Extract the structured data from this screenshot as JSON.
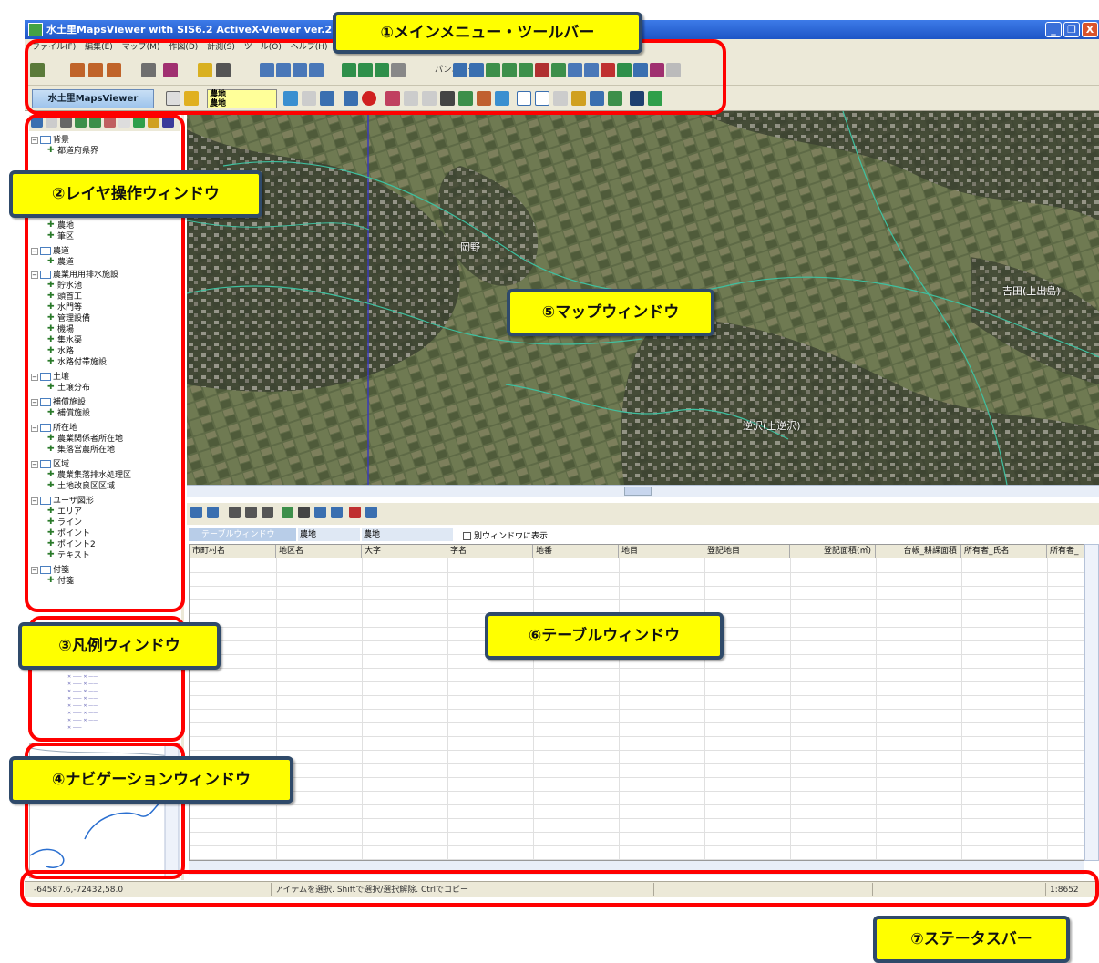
{
  "window": {
    "title": "水土里MapsViewer  with SIS6.2 ActiveX-Viewer  ver.2.018",
    "min_glyph": "_",
    "restore_glyph": "❐",
    "close_glyph": "X"
  },
  "menu": [
    "ファイル(F)",
    "編集(E)",
    "マップ(M)",
    "作図(D)",
    "計測(S)",
    "ツール(O)",
    "ヘルプ(H)"
  ],
  "toolbar": {
    "panning_label": "パンニング.",
    "logo_label": "水土里MapsViewer",
    "layer_combo_line1": "農地",
    "layer_combo_line2": "農地"
  },
  "layer_tree": [
    {
      "label": "背景",
      "type": "folder"
    },
    {
      "label": "都道府県界",
      "type": "layer"
    },
    {
      "label": "農地",
      "type": "layer"
    },
    {
      "label": "筆区",
      "type": "layer"
    },
    {
      "label": "農道",
      "type": "folder"
    },
    {
      "label": "農道",
      "type": "layer"
    },
    {
      "label": "農業用用排水施設",
      "type": "folder"
    },
    {
      "label": "貯水池",
      "type": "layer"
    },
    {
      "label": "頭首工",
      "type": "layer"
    },
    {
      "label": "水門等",
      "type": "layer"
    },
    {
      "label": "管理設備",
      "type": "layer"
    },
    {
      "label": "機場",
      "type": "layer"
    },
    {
      "label": "集水渠",
      "type": "layer"
    },
    {
      "label": "水路",
      "type": "layer"
    },
    {
      "label": "水路付帯施設",
      "type": "layer"
    },
    {
      "label": "土壌",
      "type": "folder"
    },
    {
      "label": "土壌分布",
      "type": "layer"
    },
    {
      "label": "補償施設",
      "type": "folder"
    },
    {
      "label": "補償施設",
      "type": "layer"
    },
    {
      "label": "所在地",
      "type": "folder"
    },
    {
      "label": "農業関係者所在地",
      "type": "layer"
    },
    {
      "label": "集落営農所在地",
      "type": "layer"
    },
    {
      "label": "区域",
      "type": "folder"
    },
    {
      "label": "農業集落排水処理区",
      "type": "layer"
    },
    {
      "label": "土地改良区区域",
      "type": "layer"
    },
    {
      "label": "ユーザ図形",
      "type": "folder"
    },
    {
      "label": "エリア",
      "type": "layer"
    },
    {
      "label": "ライン",
      "type": "layer"
    },
    {
      "label": "ポイント",
      "type": "layer"
    },
    {
      "label": "ポイント2",
      "type": "layer"
    },
    {
      "label": "テキスト",
      "type": "layer"
    },
    {
      "label": "付箋",
      "type": "folder"
    },
    {
      "label": "付箋",
      "type": "layer"
    }
  ],
  "map": {
    "label1": "岡野",
    "label2": "吉田(上出島)",
    "label3": "逆沢(上逆沢)"
  },
  "table": {
    "tab_label": "テーブルウィンドウ",
    "layer1": "農地",
    "layer2": "農地",
    "separate_window_label": "別ウィンドウに表示",
    "columns": [
      "市町村名",
      "地区名",
      "大字",
      "字名",
      "地番",
      "地目",
      "登記地目",
      "登記面積(㎡)",
      "台帳_耕課面積",
      "所有者_氏名",
      "所有者_"
    ]
  },
  "status": {
    "coords": "-64587.6,-72432,58.0",
    "hint": "アイテムを選択. Shiftで選択/選択解除. Ctrlでコピー",
    "scale": "1:8652"
  },
  "annotations": {
    "c1": "①メインメニュー・ツールバー",
    "c2": "②レイヤ操作ウィンドウ",
    "c3": "③凡例ウィンドウ",
    "c4": "④ナビゲーションウィンドウ",
    "c5": "⑤マップウィンドウ",
    "c6": "⑥テーブルウィンドウ",
    "c7": "⑦ステータスバー"
  },
  "colors": {
    "annotation_fill": "#ffff00",
    "annotation_border": "#2f4a6a",
    "highlight_frame": "#ff0000",
    "titlebar": "#1e55c6"
  }
}
